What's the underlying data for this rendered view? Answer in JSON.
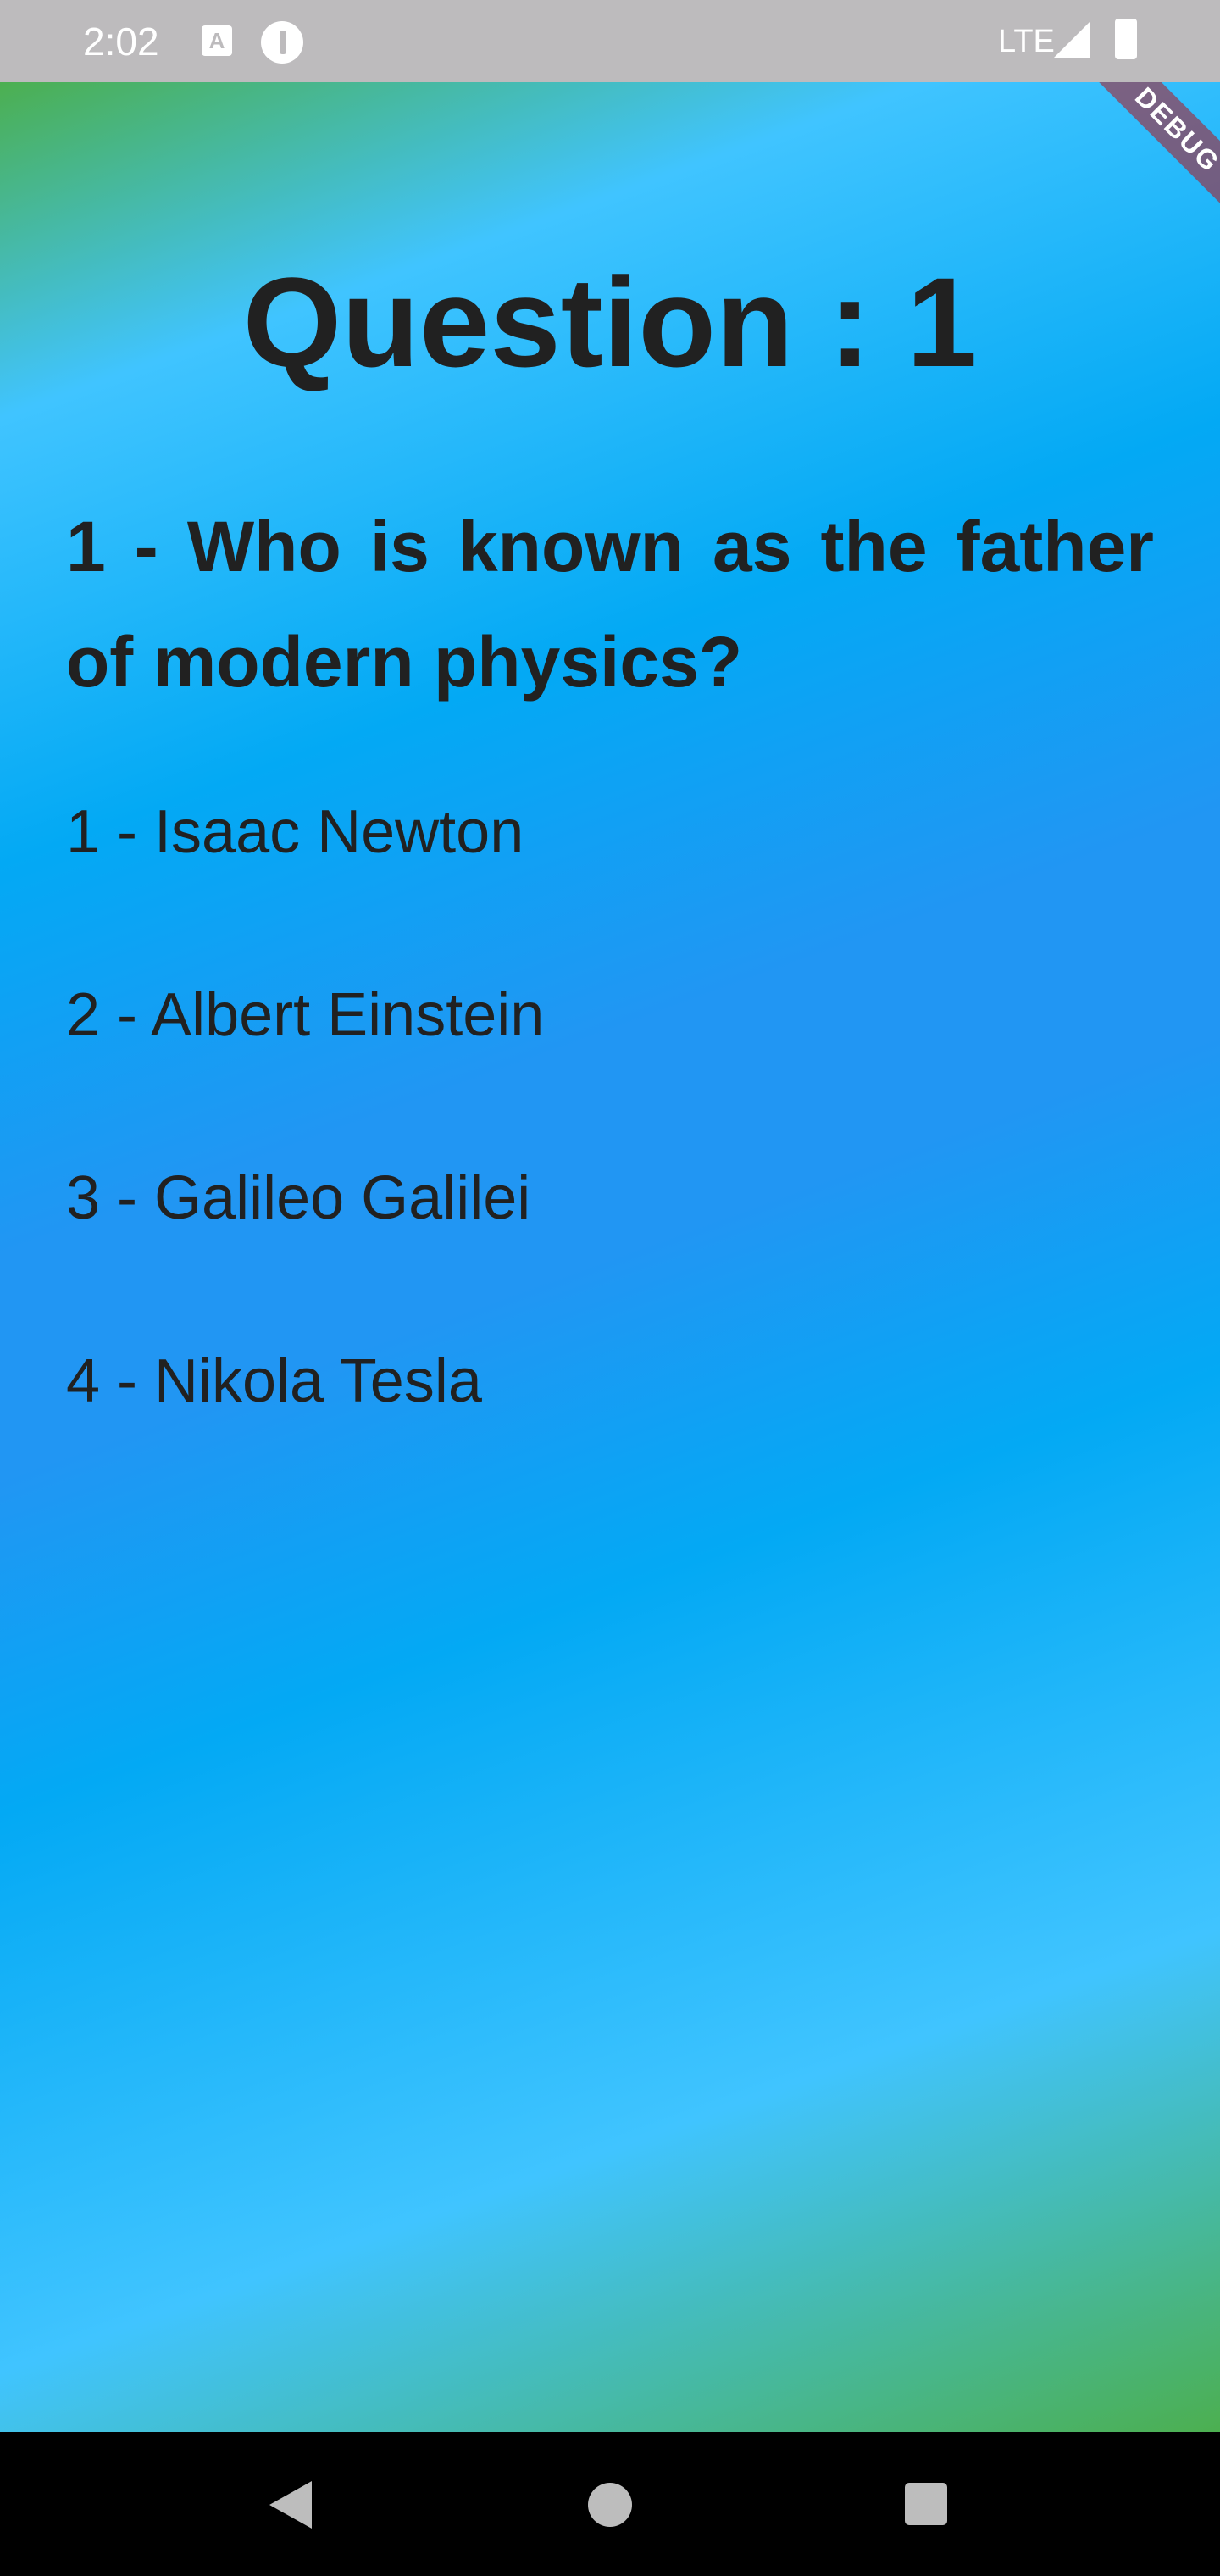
{
  "status_bar": {
    "time": "2:02",
    "a_icon_glyph": "A",
    "network": "LTE",
    "icons": [
      "text-a-icon",
      "info-circle-icon",
      "signal-icon",
      "battery-icon"
    ]
  },
  "debug_banner": "DEBUG",
  "quiz": {
    "title": "Question : 1",
    "question": "1 - Who is known as the father of modern physics?",
    "answers": [
      "1 - Isaac Newton",
      "2 - Albert Einstein",
      "3 - Galileo Galilei",
      "4 - Nikola Tesla"
    ]
  },
  "colors": {
    "gradient": [
      "#4caf50",
      "#40c4ff",
      "#03a9f4",
      "#2196f3"
    ],
    "text": "#212121",
    "status_bar": "#bdbbbd",
    "nav_bar": "#000000"
  },
  "nav_bar": {
    "icons": [
      "back-icon",
      "home-icon",
      "recents-icon"
    ]
  }
}
